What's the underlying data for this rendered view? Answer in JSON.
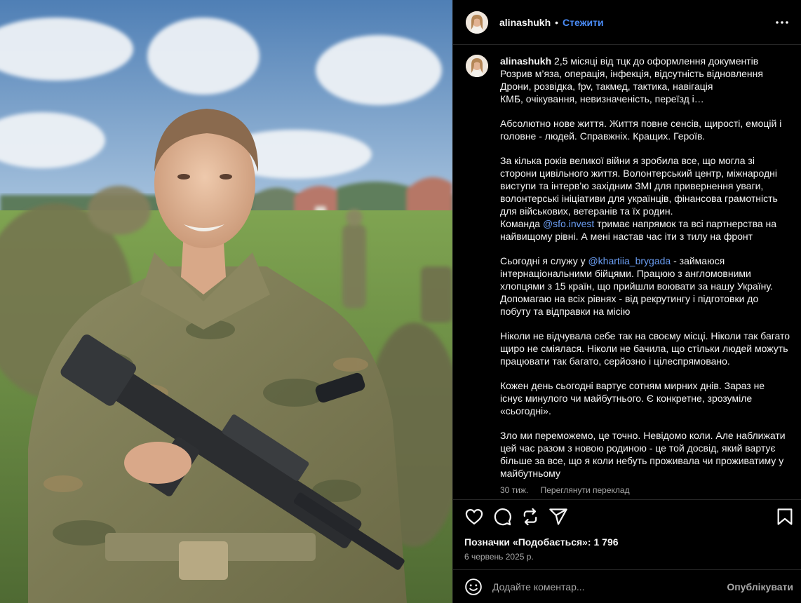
{
  "post": {
    "photo": {
      "icon": "post-photo"
    }
  },
  "header": {
    "username": "alinashukh",
    "separator": "•",
    "follow_label": "Стежити",
    "more_icon": "more-horizontal-icon"
  },
  "caption": {
    "username": "alinashukh",
    "paragraphs": [
      {
        "lines": [
          " 2,5 місяці від тцк до оформлення документів",
          "Розрив м’яза, операція, інфекція, відсутність відновлення",
          "Дрони, розвідка, fpv, такмед, тактика, навігація",
          "КМБ, очікування, невизначеність, переїзд і…"
        ]
      },
      {
        "lines": [
          "Абсолютно нове життя. Життя повне сенсів, щирості, емоцій і",
          "головне - людей. Справжніх. Кращих. Героїв."
        ]
      },
      {
        "lines": [
          "За кілька років великої війни я зробила все, що могла зі",
          "сторони цивільного життя. Волонтерський центр, міжнародні",
          "виступи та інтерв’ю західним ЗМІ для привернення уваги,",
          "волонтерські ініціативи для українців, фінансова грамотність",
          "для військових, ветеранів та їх родин."
        ],
        "mention_line": {
          "before": "Команда ",
          "mention": "@sfo.invest",
          "after": " тримає напрямок та всі партнерства на"
        },
        "tail_lines": [
          "найвищому рівні. А мені настав час іти з тилу на фронт"
        ]
      },
      {
        "mention_line": {
          "before": "Сьогодні я служу у ",
          "mention": "@khartiia_brygada",
          "after": " - займаюся"
        },
        "tail_lines": [
          "інтернаціональними бійцями. Працюю з англомовними",
          "хлопцями з 15 країн, що прийшли воювати за нашу Україну.",
          "Допомагаю на всіх рівнях - від рекрутингу і підготовки до",
          "побуту та відправки на місію"
        ]
      },
      {
        "lines": [
          "Ніколи не відчувала себе так на своєму місці. Ніколи так багато",
          "щиро не сміялася. Ніколи не бачила, що стільки людей можуть",
          "працювати так багато, серйозно і цілеспрямовано."
        ]
      },
      {
        "lines": [
          "Кожен день сьогодні вартує сотням мирних днів. Зараз не",
          "існує минулого чи майбутнього. Є конкретне, зрозуміле",
          "«сьогодні»."
        ]
      },
      {
        "lines": [
          "Зло ми переможемо, це точно. Невідомо коли. Але наближати",
          "цей час разом з новою родиною - це той досвід, який вартує",
          "більше за все, що я коли небуть проживала чи проживатиму у",
          "майбутньому"
        ]
      }
    ],
    "time_ago": "30 тиж.",
    "see_translation": "Переглянути переклад"
  },
  "actions": {
    "like_icon": "heart-icon",
    "comment_icon": "comment-icon",
    "repost_icon": "repost-icon",
    "share_icon": "send-icon",
    "save_icon": "bookmark-icon"
  },
  "likes_label": "Позначки «Подобається»: 1 796",
  "date": "6 червень 2025 р.",
  "comment": {
    "emoji_icon": "emoji-icon",
    "placeholder": "Додайте коментар...",
    "publish_label": "Опублікувати"
  },
  "colors": {
    "background": "#000000",
    "text": "#f5f5f5",
    "muted": "#a8a8a8",
    "link": "#4a8cf7",
    "mention": "#6b9ef3",
    "divider": "#262626"
  }
}
